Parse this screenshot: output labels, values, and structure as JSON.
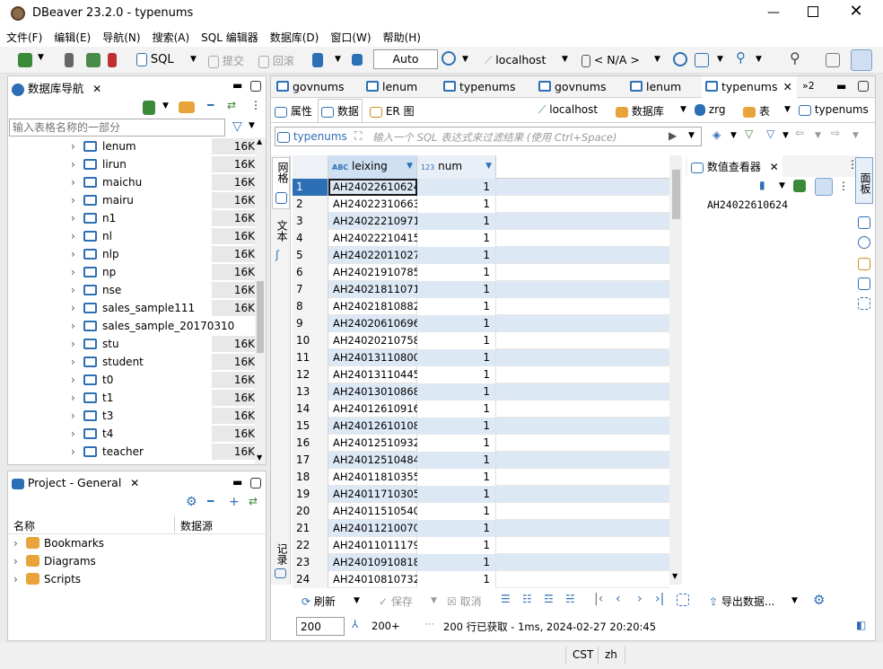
{
  "window": {
    "title": "DBeaver 23.2.0 - typenums"
  },
  "menu": [
    "文件(F)",
    "编辑(E)",
    "导航(N)",
    "搜索(A)",
    "SQL 编辑器",
    "数据库(D)",
    "窗口(W)",
    "帮助(H)"
  ],
  "toolbar": {
    "sql_label": "SQL",
    "commit_label": "提交",
    "rollback_label": "回滚",
    "mode_value": "Auto",
    "connection": "localhost",
    "schema": "< N/A >"
  },
  "navigator": {
    "title": "数据库导航",
    "filter_placeholder": "输入表格名称的一部分",
    "items": [
      {
        "name": "lenum",
        "size": "16K"
      },
      {
        "name": "lirun",
        "size": "16K"
      },
      {
        "name": "maichu",
        "size": "16K"
      },
      {
        "name": "mairu",
        "size": "16K"
      },
      {
        "name": "n1",
        "size": "16K"
      },
      {
        "name": "nl",
        "size": "16K"
      },
      {
        "name": "nlp",
        "size": "16K"
      },
      {
        "name": "np",
        "size": "16K"
      },
      {
        "name": "nse",
        "size": "16K"
      },
      {
        "name": "sales_sample111",
        "size": "16K"
      },
      {
        "name": "sales_sample_20170310",
        "size": ""
      },
      {
        "name": "stu",
        "size": "16K"
      },
      {
        "name": "student",
        "size": "16K"
      },
      {
        "name": "t0",
        "size": "16K"
      },
      {
        "name": "t1",
        "size": "16K"
      },
      {
        "name": "t3",
        "size": "16K"
      },
      {
        "name": "t4",
        "size": "16K"
      },
      {
        "name": "teacher",
        "size": "16K"
      }
    ]
  },
  "project": {
    "title": "Project - General",
    "col_name": "名称",
    "col_source": "数据源",
    "items": [
      "Bookmarks",
      "Diagrams",
      "Scripts"
    ]
  },
  "editor_tabs": [
    "govnums",
    "lenum",
    "typenums",
    "govnums",
    "lenum",
    "typenums"
  ],
  "editor_tabs_overflow": "»2",
  "subtabs": {
    "props": "属性",
    "data": "数据",
    "er": "ER 图"
  },
  "subtoolbar": {
    "conn": "localhost",
    "db": "数据库",
    "schema": "zrg",
    "table": "表",
    "entity": "typenums"
  },
  "filter": {
    "entity": "typenums",
    "placeholder": "输入一个 SQL 表达式来过滤结果 (使用 Ctrl+Space)"
  },
  "side_tabs": {
    "grid": "网格",
    "text": "文本",
    "record": "记录"
  },
  "grid": {
    "columns": [
      {
        "type": "ABC",
        "name": "leixing"
      },
      {
        "type": "123",
        "name": "num"
      }
    ],
    "rows": [
      {
        "n": "1",
        "leixing": "AH24022610624",
        "num": "1"
      },
      {
        "n": "2",
        "leixing": "AH24022310663",
        "num": "1"
      },
      {
        "n": "3",
        "leixing": "AH24022210971",
        "num": "1"
      },
      {
        "n": "4",
        "leixing": "AH24022210415",
        "num": "1"
      },
      {
        "n": "5",
        "leixing": "AH24022011027",
        "num": "1"
      },
      {
        "n": "6",
        "leixing": "AH24021910785",
        "num": "1"
      },
      {
        "n": "7",
        "leixing": "AH24021811071",
        "num": "1"
      },
      {
        "n": "8",
        "leixing": "AH24021810882",
        "num": "1"
      },
      {
        "n": "9",
        "leixing": "AH24020610696",
        "num": "1"
      },
      {
        "n": "10",
        "leixing": "AH24020210758",
        "num": "1"
      },
      {
        "n": "11",
        "leixing": "AH24013110800",
        "num": "1"
      },
      {
        "n": "12",
        "leixing": "AH24013110445",
        "num": "1"
      },
      {
        "n": "13",
        "leixing": "AH24013010868",
        "num": "1"
      },
      {
        "n": "14",
        "leixing": "AH24012610916",
        "num": "1"
      },
      {
        "n": "15",
        "leixing": "AH24012610108",
        "num": "1"
      },
      {
        "n": "16",
        "leixing": "AH24012510932",
        "num": "1"
      },
      {
        "n": "17",
        "leixing": "AH24012510484",
        "num": "1"
      },
      {
        "n": "18",
        "leixing": "AH24011810355",
        "num": "1"
      },
      {
        "n": "19",
        "leixing": "AH24011710305",
        "num": "1"
      },
      {
        "n": "20",
        "leixing": "AH24011510540",
        "num": "1"
      },
      {
        "n": "21",
        "leixing": "AH24011210070",
        "num": "1"
      },
      {
        "n": "22",
        "leixing": "AH24011011179",
        "num": "1"
      },
      {
        "n": "23",
        "leixing": "AH24010910818",
        "num": "1"
      },
      {
        "n": "24",
        "leixing": "AH24010810732",
        "num": "1"
      }
    ]
  },
  "value_viewer": {
    "title": "数值查看器",
    "value": "AH24022610624"
  },
  "right_tab": "面板",
  "bottom": {
    "refresh": "刷新",
    "save": "保存",
    "cancel": "取消",
    "export": "导出数据...",
    "fetch_size": "200",
    "fetch_more": "200+",
    "status": "200 行已获取 - 1ms, 2024-02-27 20:20:45"
  },
  "statusbar": {
    "tz": "CST",
    "locale": "zh"
  },
  "colors": {
    "accent": "#2d6fb5",
    "selected_row": "#dde8f5",
    "header": "#e9eff7"
  }
}
